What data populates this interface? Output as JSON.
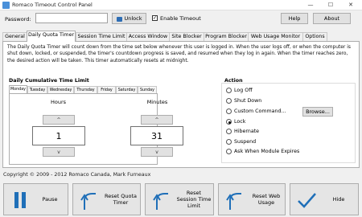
{
  "window": {
    "title": "Romaco Timeout Control Panel",
    "minimize": "—",
    "maximize": "☐",
    "close": "✕"
  },
  "topbar": {
    "password_label": "Password:",
    "password_value": "",
    "unlock_label": "Unlock",
    "enable_timeout_label": "Enable Timeout",
    "enable_timeout_checked": true,
    "help_label": "Help",
    "about_label": "About"
  },
  "tabs": [
    "General",
    "Daily Quota Timer",
    "Session Time Limit",
    "Access Window",
    "Site Blocker",
    "Program Blocker",
    "Web Usage Monitor",
    "Options"
  ],
  "active_tab": "Daily Quota Timer",
  "description": "The Daily Quota Timer will count down from the time set below whenever this user is logged in. When the user logs off, or when the computer is shut down, locked, or suspended, the timer's countdown progress is saved, and resumed when they log in again. When the timer reaches zero, the desired action will be taken. This timer automatically resets at midnight.",
  "limit": {
    "title": "Daily Cumulative Time Limit",
    "days": [
      "Monday",
      "Tuesday",
      "Wednesday",
      "Thursday",
      "Friday",
      "Saturday",
      "Sunday"
    ],
    "active_day": "Monday",
    "hours_label": "Hours",
    "hours_value": "1",
    "minutes_label": "Minutes",
    "minutes_value": "31",
    "up": "^",
    "down": "v"
  },
  "action": {
    "title": "Action",
    "options": [
      "Log Off",
      "Shut Down",
      "Custom Command...",
      "Lock",
      "Hibernate",
      "Suspend",
      "Ask When Module Expires"
    ],
    "selected": "Lock",
    "browse_label": "Browse..."
  },
  "copyright": "Copyright © 2009 - 2012 Romaco Canada, Mark Furneaux",
  "buttons": {
    "pause": "Pause",
    "reset_quota": "Reset Quota\nTimer",
    "reset_session": "Reset\nSession Time\nLimit",
    "reset_web": "Reset Web\nUsage",
    "hide": "Hide"
  },
  "colors": {
    "accent": "#1a5fa8",
    "pause_icon": "#1f6fb8"
  }
}
